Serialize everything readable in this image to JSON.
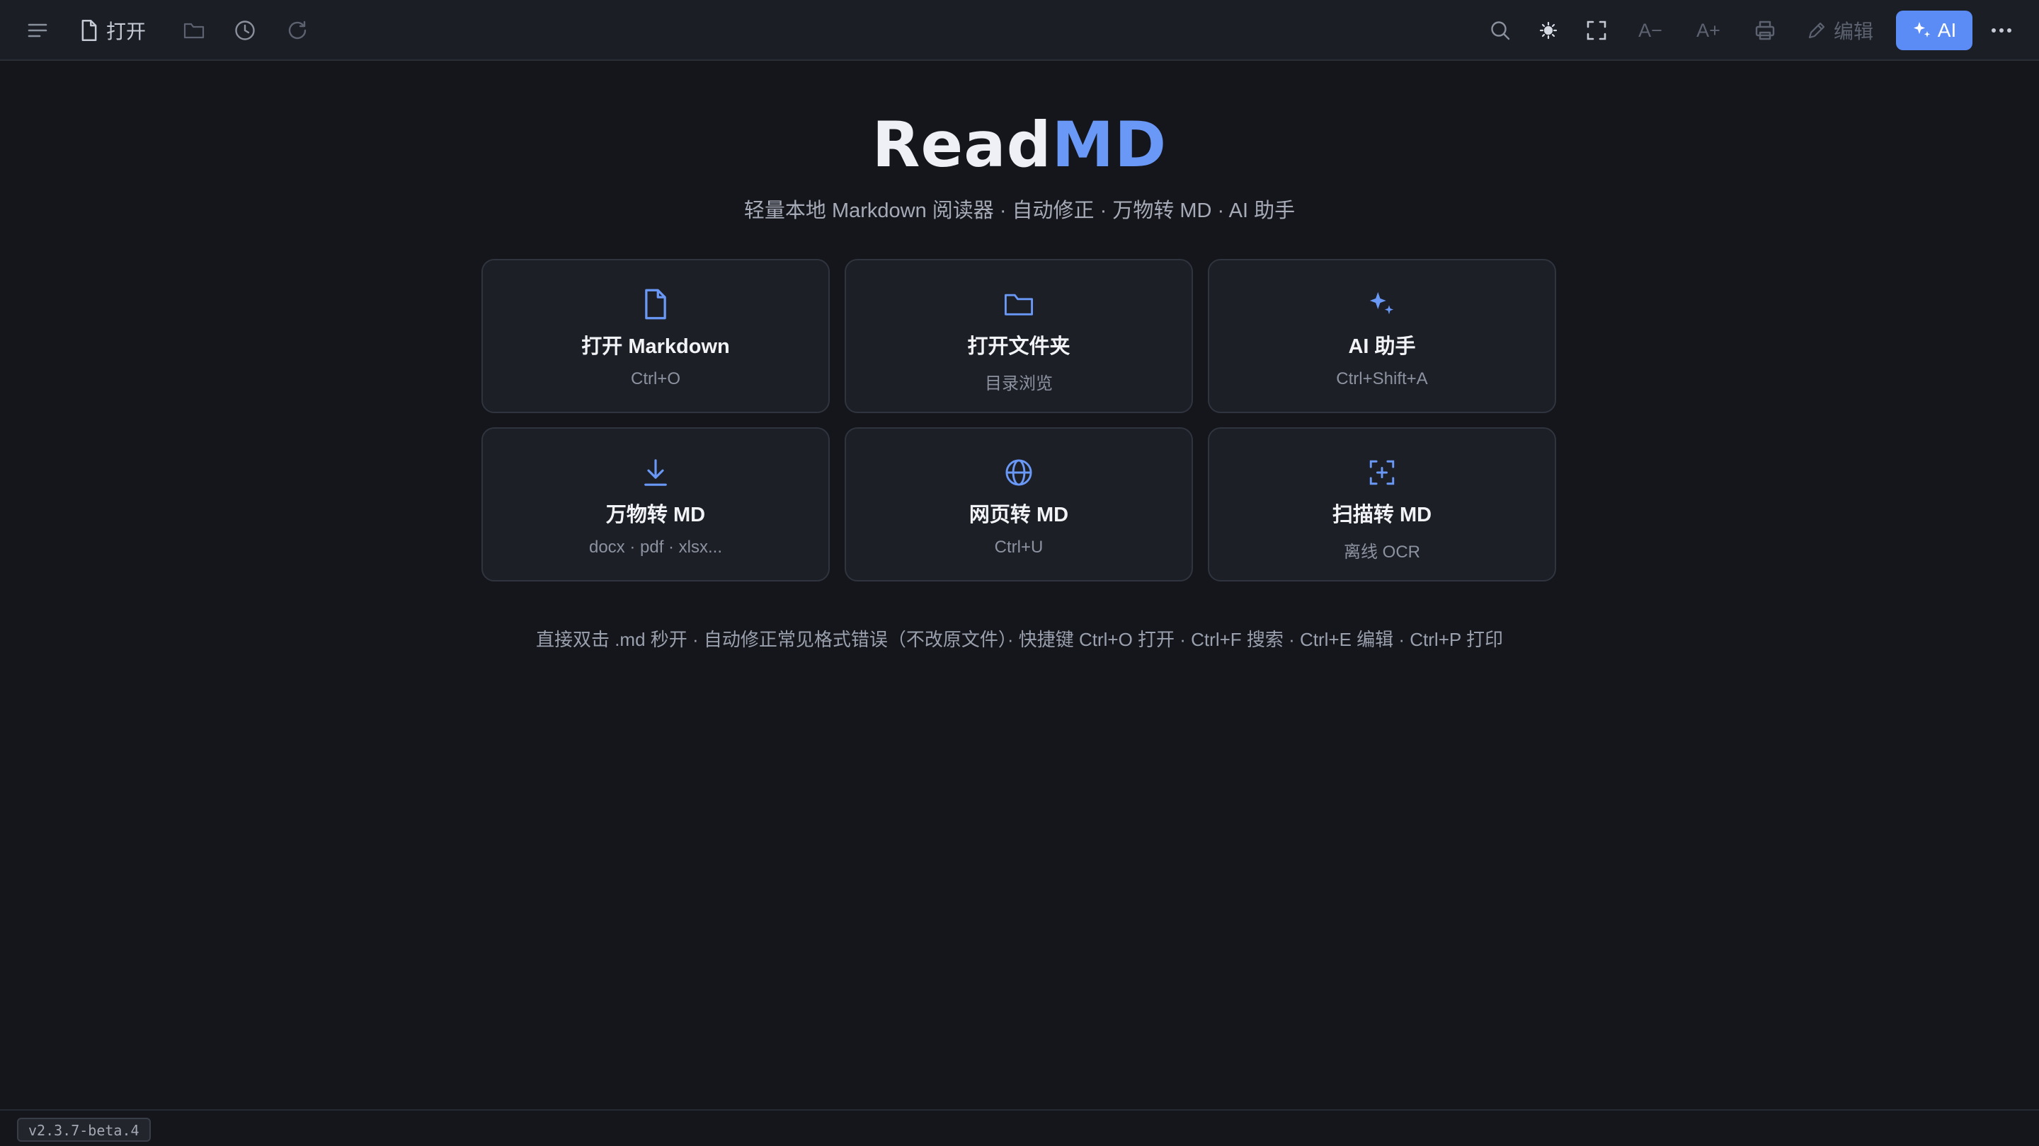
{
  "toolbar": {
    "menu_icon": "menu-icon",
    "open_label": "打开",
    "edit_label": "编辑",
    "ai_label": "AI",
    "font_decrease_label": "A−",
    "font_increase_label": "A+"
  },
  "hero": {
    "brand_read": "Read",
    "brand_md": "MD",
    "tagline": "轻量本地 Markdown 阅读器 · 自动修正 · 万物转 MD · AI 助手"
  },
  "cards": [
    {
      "icon": "file-icon",
      "title": "打开 Markdown",
      "sub": "Ctrl+O"
    },
    {
      "icon": "folder-icon",
      "title": "打开文件夹",
      "sub": "目录浏览"
    },
    {
      "icon": "sparkle-icon",
      "title": "AI 助手",
      "sub": "Ctrl+Shift+A"
    },
    {
      "icon": "download-icon",
      "title": "万物转 MD",
      "sub": "docx · pdf · xlsx..."
    },
    {
      "icon": "globe-icon",
      "title": "网页转 MD",
      "sub": "Ctrl+U"
    },
    {
      "icon": "scan-icon",
      "title": "扫描转 MD",
      "sub": "离线 OCR"
    }
  ],
  "hint": "直接双击 .md 秒开 · 自动修正常见格式错误（不改原文件）· 快捷键 Ctrl+O 打开 · Ctrl+F 搜索 · Ctrl+E 编辑 · Ctrl+P 打印",
  "status": {
    "version": "v2.3.7-beta.4"
  },
  "colors": {
    "background": "#14161b",
    "toolbar": "#1b1e25",
    "accent": "#6a98f7",
    "ai_button": "#5b8cf5",
    "card": "#1c1f26"
  }
}
